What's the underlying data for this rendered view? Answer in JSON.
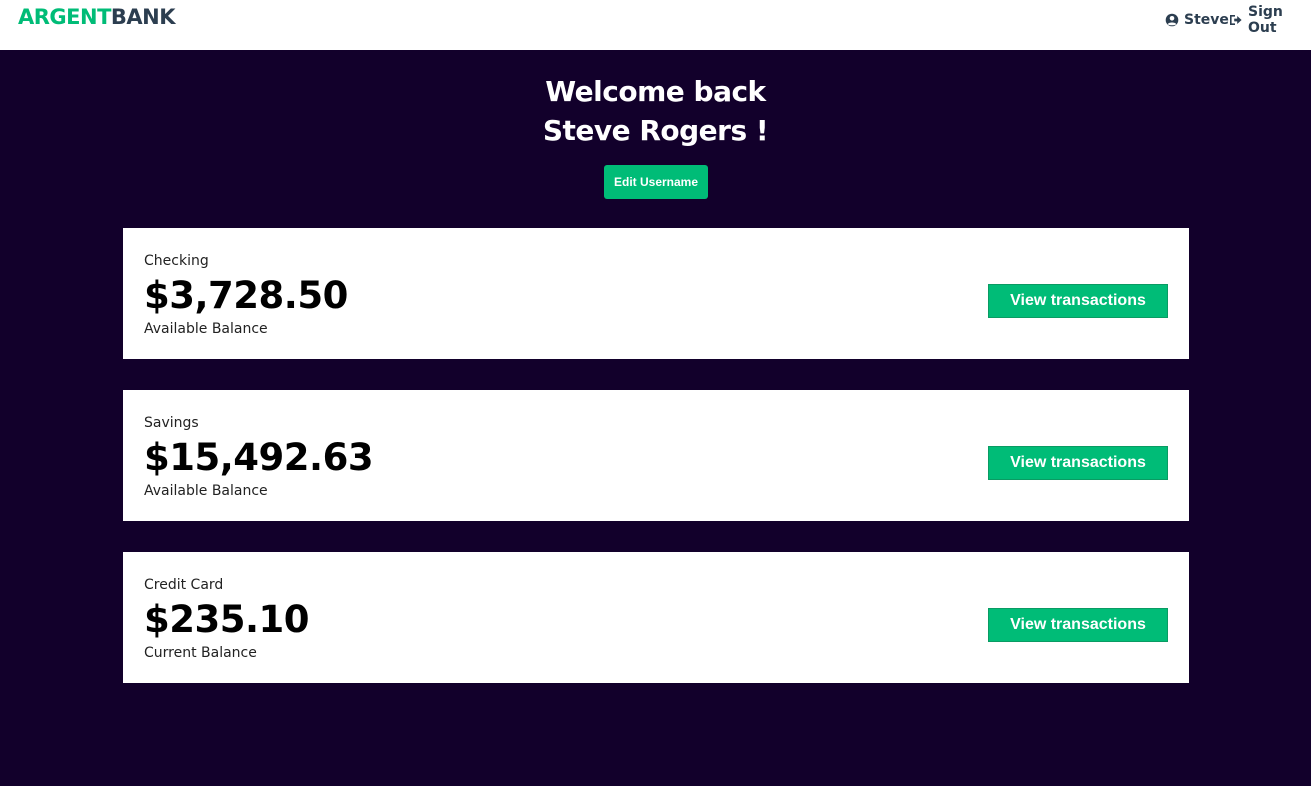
{
  "nav": {
    "logo_part1": "ARGENT",
    "logo_part2": "BANK",
    "user_name": "Steve",
    "sign_out": "Sign Out",
    "user_icon": "user-circle-icon",
    "sign_out_icon": "sign-out-icon"
  },
  "header": {
    "welcome_line1": "Welcome back",
    "welcome_line2": "Steve Rogers !",
    "edit_button": "Edit Username"
  },
  "accounts": [
    {
      "title": "Checking",
      "amount": "$3,728.50",
      "description": "Available Balance",
      "button": "View transactions"
    },
    {
      "title": "Savings",
      "amount": "$15,492.63",
      "description": "Available Balance",
      "button": "View transactions"
    },
    {
      "title": "Credit Card",
      "amount": "$235.10",
      "description": "Current Balance",
      "button": "View transactions"
    }
  ],
  "colors": {
    "accent": "#00bc77",
    "background": "#12002b",
    "nav_text": "#2c3e50"
  }
}
